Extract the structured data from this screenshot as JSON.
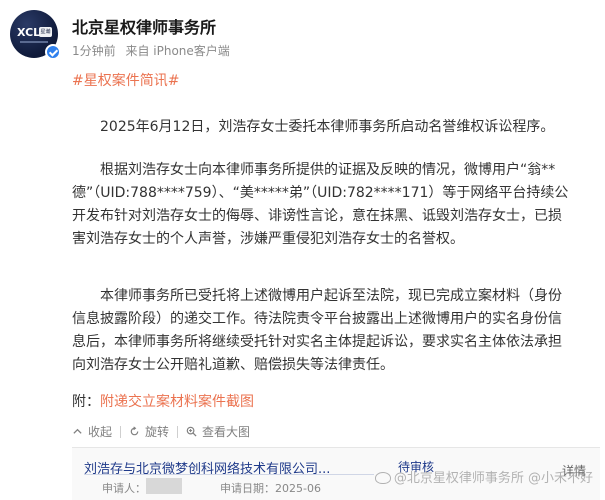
{
  "header": {
    "avatar_logo_text": "XCL",
    "avatar_badge_text": "星瀚",
    "account_name": "北京星权律师事务所",
    "time_ago": "1分钟前",
    "source": "来自 iPhone客户端"
  },
  "post": {
    "topic": "#星权案件简讯#",
    "paragraph1": [
      "2025年6月12日，刘浩存女士委托本律师事务所启动名誉维权诉讼程序。"
    ],
    "paragraph2": [
      "根据刘浩存女士向本律师事务所提供的证据及反映的情况，微博用户“翁**",
      "德”（UID:788****759）、“美*****弟”（UID:782****171）等于网络平台持续公",
      "开发布针对刘浩存女士的侮辱、诽谤性言论，意在抹黑、诋毁刘浩存女士，已损",
      "害刘浩存女士的个人声誉，涉嫌严重侵犯刘浩存女士的名誉权。"
    ],
    "paragraph3": [
      "本律师事务所已受托将上述微博用户起诉至法院，现已完成立案材料（身份",
      "信息披露阶段）的递交工作。待法院责令平台披露出上述微博用户的实名身份信",
      "息后，本律师事务所将继续受托针对实名主体提起诉讼，要求实名主体依法承担",
      "向刘浩存女士公开赔礼道歉、赔偿损失等法律责任。"
    ],
    "attachment_prefix": "附：",
    "attachment_link": "附递交立案材料案件截图"
  },
  "actions": {
    "collapse": "收起",
    "rotate": "旋转",
    "view_large": "查看大图"
  },
  "preview": {
    "doc_title": "刘浩存与北京微梦创科网络技术有限公司...",
    "status": "待审核",
    "detail": "详情",
    "applicant_label": "申请人：",
    "apply_date": "申请日期：2025-06"
  },
  "watermark": "@北京星权律师事务所  @小禾不好",
  "colors": {
    "accent": "#eb7350",
    "verify": "#2f80ed",
    "doc_blue": "#1f3a8a"
  }
}
